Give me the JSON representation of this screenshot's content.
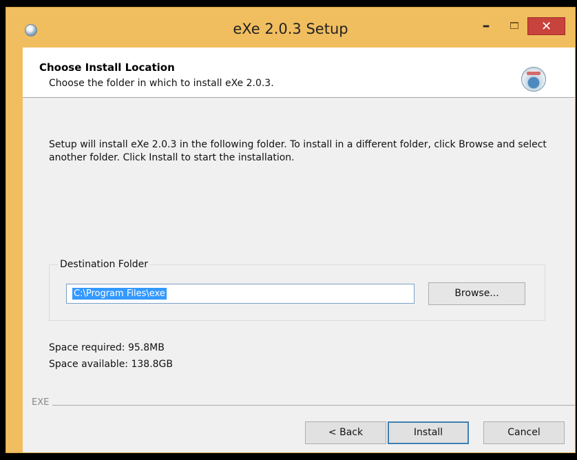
{
  "window": {
    "title": "eXe 2.0.3 Setup",
    "controls": {
      "minimize": "–",
      "close": "✕"
    },
    "icon": "installer-disc-icon"
  },
  "header": {
    "title": "Choose Install Location",
    "subtitle": "Choose the folder in which to install eXe 2.0.3.",
    "icon": "nsis-install-icon"
  },
  "body": {
    "intro": "Setup will install eXe 2.0.3 in the following folder. To install in a different folder, click Browse and select another folder. Click Install to start the installation.",
    "destination": {
      "group_label": "Destination Folder",
      "path_value": "C:\\Program Files\\exe",
      "browse_label": "Browse..."
    },
    "space_required": "Space required: 95.8MB",
    "space_available": "Space available: 138.8GB",
    "brand": "EXE"
  },
  "footer": {
    "back_label": "< Back",
    "install_label": "Install",
    "cancel_label": "Cancel"
  },
  "colors": {
    "titlebar": "#f1be5f",
    "close_button": "#c7433b",
    "selection": "#3399ff",
    "dialog_bg": "#f0f0f0"
  }
}
